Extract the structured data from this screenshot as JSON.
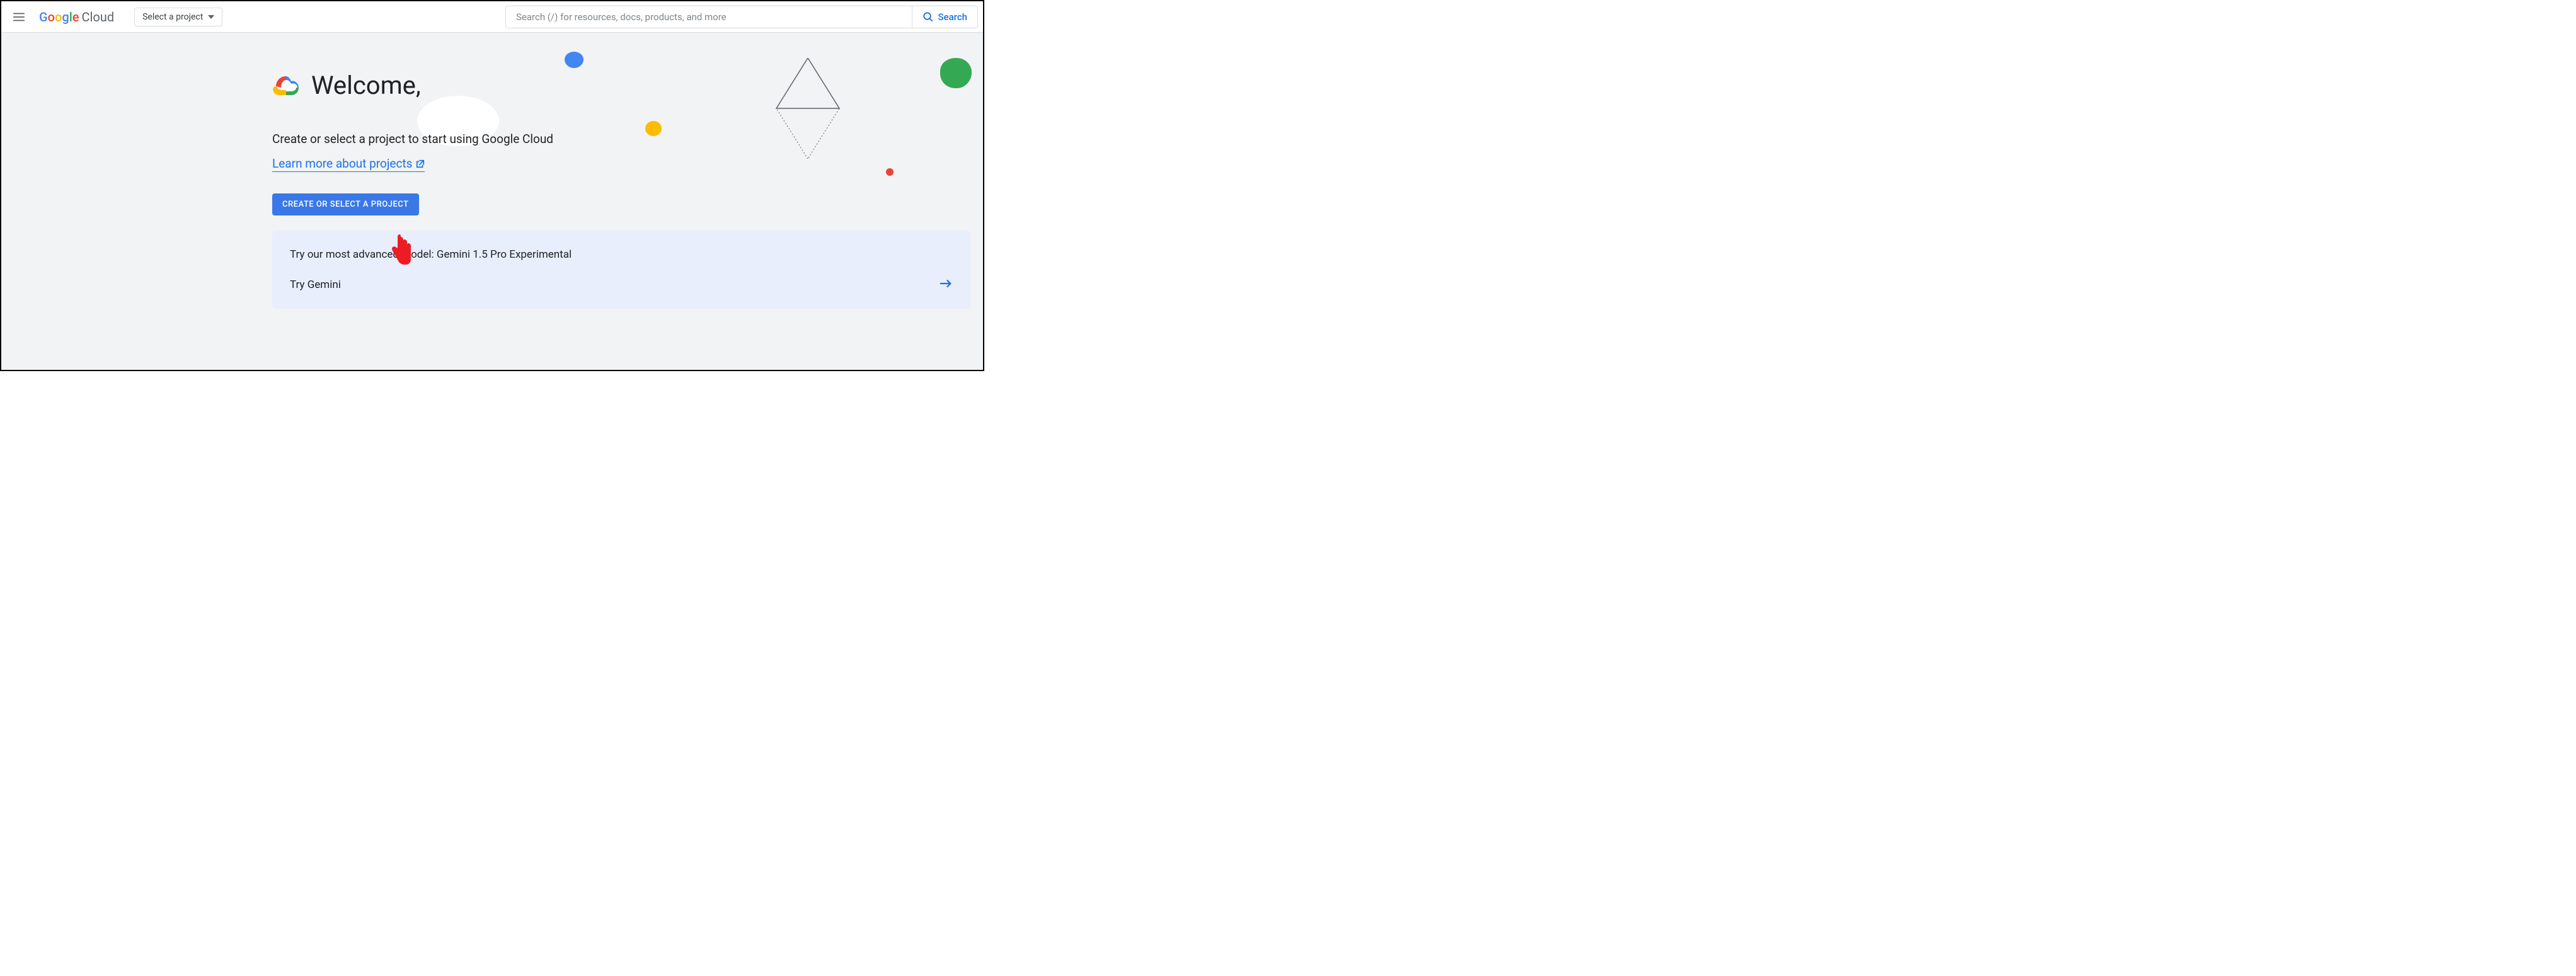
{
  "header": {
    "logo_google_letters": [
      "G",
      "o",
      "o",
      "g",
      "l",
      "e"
    ],
    "logo_cloud": "Cloud",
    "project_selector_label": "Select a project",
    "search_placeholder": "Search (/) for resources, docs, products, and more",
    "search_button_label": "Search"
  },
  "main": {
    "welcome_title": "Welcome,",
    "subtitle": "Create or select a project to start using Google Cloud",
    "learn_more_label": "Learn more about projects",
    "create_button_label": "CREATE OR SELECT A PROJECT"
  },
  "promo": {
    "title": "Try our most advanced model: Gemini 1.5 Pro Experimental",
    "action_label": "Try Gemini"
  }
}
